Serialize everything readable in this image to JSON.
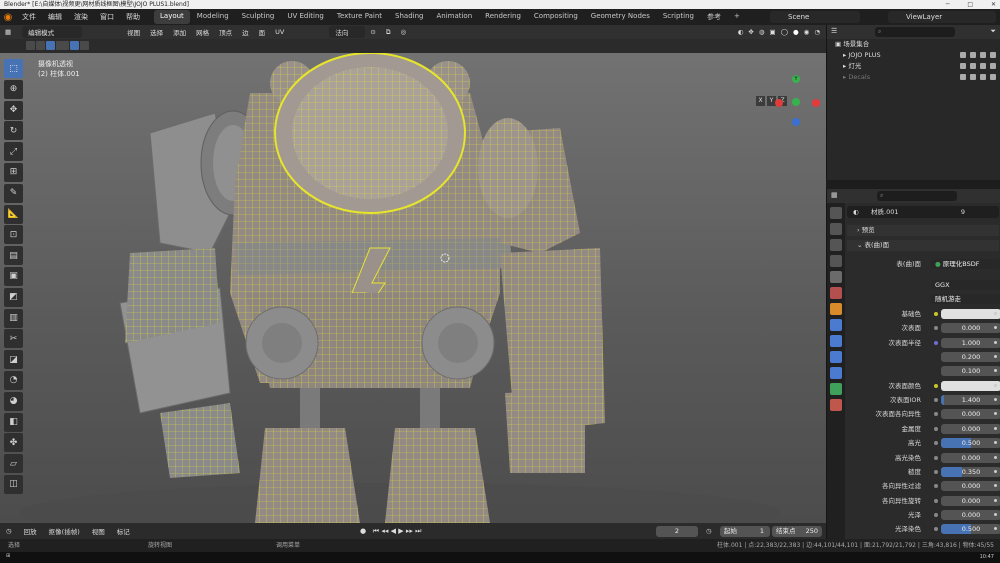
{
  "title_bar": {
    "text": "Blender* [E:\\自媒体\\视频更\\网材质线框图\\模型\\JOJO PLUS1.blend]",
    "minimize": "─",
    "maximize": "□",
    "close": "✕"
  },
  "menu": [
    "文件",
    "编辑",
    "渲染",
    "窗口",
    "帮助"
  ],
  "workspaces": [
    {
      "label": "Layout",
      "active": true
    },
    {
      "label": "Modeling"
    },
    {
      "label": "Sculpting"
    },
    {
      "label": "UV Editing"
    },
    {
      "label": "Texture Paint"
    },
    {
      "label": "Shading"
    },
    {
      "label": "Animation"
    },
    {
      "label": "Rendering"
    },
    {
      "label": "Compositing"
    },
    {
      "label": "Geometry Nodes"
    },
    {
      "label": "Scripting"
    },
    {
      "label": "参考"
    },
    {
      "label": "+"
    }
  ],
  "scene": "Scene",
  "view_layer": "ViewLayer",
  "viewport_header": {
    "mode": "编辑模式",
    "menus": [
      "视图",
      "选择",
      "添加",
      "网格",
      "顶点",
      "边",
      "面",
      "UV"
    ],
    "orientation": "法向"
  },
  "viewport": {
    "camera_label": "摄像机透视",
    "object_label": "(2) 柱体.001",
    "axis_buttons": [
      "X",
      "Y",
      "Z"
    ],
    "options": "选项",
    "gizmo": {
      "colors": {
        "x": "#e23b3b",
        "y": "#37b24d",
        "z": "#3a70d1"
      },
      "labels": {
        "y": "Y"
      }
    }
  },
  "toolbar_icons": [
    "select-box-icon",
    "cursor-icon",
    "move-icon",
    "rotate-icon",
    "scale-icon",
    "transform-icon",
    "annotate-icon",
    "measure-icon",
    "add-cube-icon",
    "extrude-icon",
    "inset-icon",
    "bevel-icon",
    "loop-cut-icon",
    "knife-icon",
    "poly-build-icon",
    "spin-icon",
    "smooth-icon",
    "edge-slide-icon",
    "shrink-icon",
    "shear-icon",
    "rip-icon"
  ],
  "timeline": {
    "menus": [
      "回放",
      "抠像(插帧)",
      "视图",
      "标记"
    ],
    "current_frame": "2",
    "start_label": "起始",
    "start": "1",
    "end_label": "结束点",
    "end": "250"
  },
  "status_bar": {
    "left": "选择",
    "mid1": "旋转视图",
    "mid2": "调用菜单",
    "right": "柱体.001 | 点:22,383/22,383 | 边:44,101/44,101 | 面:21,792/21,792 | 三角:43,816 | 物体:45/55"
  },
  "taskbar": {
    "time": "10:47"
  },
  "outliner": {
    "rows": [
      {
        "label": "场景集合",
        "dim": false
      },
      {
        "label": "JOJO PLUS",
        "dim": false
      },
      {
        "label": "灯光",
        "dim": false
      },
      {
        "label": "Decals",
        "dim": true
      }
    ]
  },
  "properties": {
    "material_name": "材质.001",
    "material_users": "9",
    "sections": {
      "preview": "预览",
      "surface": "表(曲)面"
    },
    "surface_shader": "原理化BSDF",
    "surface_label": "表(曲)面",
    "distribution": "GGX",
    "subsurface_method": "随机游走",
    "rows": [
      {
        "label": "基础色",
        "value": "",
        "kind": "swatch",
        "dot": "yellow"
      },
      {
        "label": "次表面",
        "value": "0.000",
        "dot": "gray"
      },
      {
        "label": "次表面半径",
        "value": "1.000",
        "dot": "blue"
      },
      {
        "label": "",
        "value": "0.200",
        "dot": "none"
      },
      {
        "label": "",
        "value": "0.100",
        "dot": "none"
      },
      {
        "label": "次表面颜色",
        "value": "",
        "kind": "swatch",
        "dot": "yellow"
      },
      {
        "label": "次表面IOR",
        "value": "1.400",
        "dot": "gray",
        "fill": 0.05
      },
      {
        "label": "次表面各向异性",
        "value": "0.000",
        "dot": "gray"
      },
      {
        "label": "金属度",
        "value": "0.000",
        "dot": "gray"
      },
      {
        "label": "高光",
        "value": "0.500",
        "dot": "gray",
        "fill": 0.5
      },
      {
        "label": "高光染色",
        "value": "0.000",
        "dot": "gray"
      },
      {
        "label": "糙度",
        "value": "0.350",
        "dot": "gray",
        "fill": 0.35
      },
      {
        "label": "各向异性过滤",
        "value": "0.000",
        "dot": "gray"
      },
      {
        "label": "各向异性旋转",
        "value": "0.000",
        "dot": "gray"
      },
      {
        "label": "光泽",
        "value": "0.000",
        "dot": "gray"
      },
      {
        "label": "光泽染色",
        "value": "0.500",
        "dot": "gray",
        "fill": 0.5
      }
    ]
  },
  "colors": {
    "accent": "#4772b3",
    "wire": "#e6e52c",
    "blender_orange": "#e87d0d"
  }
}
